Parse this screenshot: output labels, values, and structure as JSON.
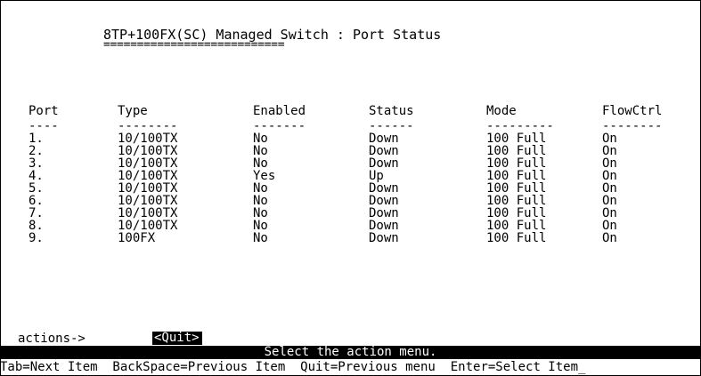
{
  "screen": {
    "title": "8TP+100FX(SC) Managed Switch : Port Status",
    "title_underline": "==========================="
  },
  "table": {
    "headers": {
      "port": "Port",
      "type": "Type",
      "enabled": "Enabled",
      "status": "Status",
      "mode": "Mode",
      "flowctrl": "FlowCtrl"
    },
    "dashes": {
      "port": "----",
      "type": "--------",
      "enabled": "-------",
      "status": "------",
      "mode": "---------",
      "flowctrl": "--------"
    },
    "rows": [
      {
        "port": "1.",
        "type": "10/100TX",
        "enabled": "No",
        "status": "Down",
        "mode": "100 Full",
        "flowctrl": "On"
      },
      {
        "port": "2.",
        "type": "10/100TX",
        "enabled": "No",
        "status": "Down",
        "mode": "100 Full",
        "flowctrl": "On"
      },
      {
        "port": "3.",
        "type": "10/100TX",
        "enabled": "No",
        "status": "Down",
        "mode": "100 Full",
        "flowctrl": "On"
      },
      {
        "port": "4.",
        "type": "10/100TX",
        "enabled": "Yes",
        "status": "Up",
        "mode": "100 Full",
        "flowctrl": "On"
      },
      {
        "port": "5.",
        "type": "10/100TX",
        "enabled": "No",
        "status": "Down",
        "mode": "100 Full",
        "flowctrl": "On"
      },
      {
        "port": "6.",
        "type": "10/100TX",
        "enabled": "No",
        "status": "Down",
        "mode": "100 Full",
        "flowctrl": "On"
      },
      {
        "port": "7.",
        "type": "10/100TX",
        "enabled": "No",
        "status": "Down",
        "mode": "100 Full",
        "flowctrl": "On"
      },
      {
        "port": "8.",
        "type": "10/100TX",
        "enabled": "No",
        "status": "Down",
        "mode": "100 Full",
        "flowctrl": "On"
      },
      {
        "port": "9.",
        "type": "100FX",
        "enabled": "No",
        "status": "Down",
        "mode": "100 Full",
        "flowctrl": "On"
      }
    ]
  },
  "actions": {
    "label": "actions->",
    "quit_label": "<Quit>"
  },
  "status_bar": {
    "message": "Select the action menu."
  },
  "help_line": {
    "text": "Tab=Next Item  BackSpace=Previous Item  Quit=Previous menu  Enter=Select Item_"
  },
  "colors": {
    "background": "#ffffff",
    "foreground": "#000000",
    "highlight_bg": "#000000",
    "highlight_fg": "#ffffff"
  }
}
